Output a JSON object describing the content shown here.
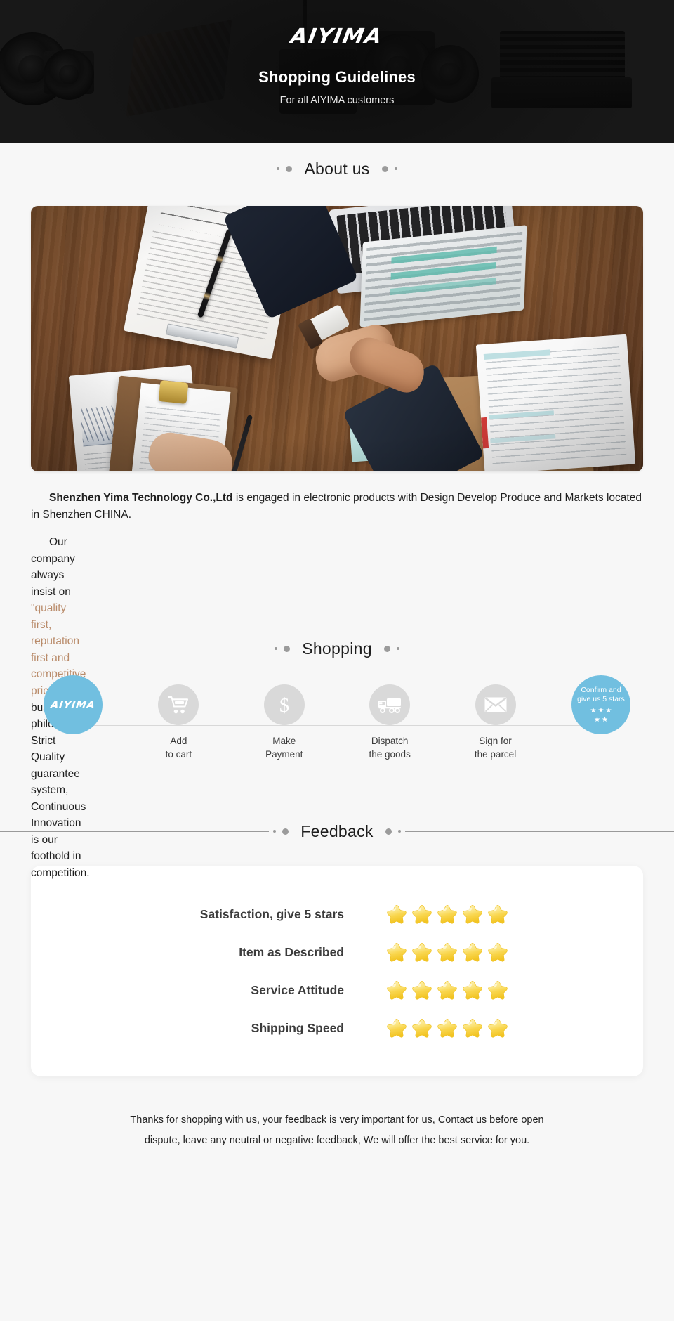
{
  "banner": {
    "logo": "AIYIMA",
    "title": "Shopping Guidelines",
    "subtitle": "For all AIYIMA customers"
  },
  "sections": {
    "about": {
      "title": "About us"
    },
    "shopping": {
      "title": "Shopping"
    },
    "feedback": {
      "title": "Feedback"
    }
  },
  "about": {
    "photo_alt": "business-handshake-over-desk-photo",
    "paragraph1_company": "Shenzhen Yima Technology Co.,Ltd",
    "paragraph1_rest": " is engaged in electronic products with Design Develop Produce and Markets located in Shenzhen CHINA.",
    "paragraph2_before": "Our company always insist on ",
    "paragraph2_quote": "\"quality first, reputation first and competitive price\"",
    "paragraph2_after": " bussiness philosophy. Strict Quality guarantee system, Continuous Innovation is our foothold in competition."
  },
  "shopping": {
    "steps": [
      {
        "icon": "aiyima-logo-icon",
        "label_line1": "AIYIMA",
        "label_line2": "",
        "style": "brand"
      },
      {
        "icon": "shopping-cart-icon",
        "label_line1": "Add",
        "label_line2": "to cart",
        "style": "gray"
      },
      {
        "icon": "dollar-sign-icon",
        "label_line1": "Make",
        "label_line2": "Payment",
        "style": "gray"
      },
      {
        "icon": "delivery-truck-icon",
        "label_line1": "Dispatch",
        "label_line2": "the goods",
        "style": "gray"
      },
      {
        "icon": "envelope-icon",
        "label_line1": "Sign for",
        "label_line2": "the parcel",
        "style": "gray"
      },
      {
        "icon": "five-stars-icon",
        "label_line1": "Confirm and",
        "label_line2": "give us 5 stars",
        "style": "end-brand"
      }
    ]
  },
  "feedback": {
    "rows": [
      {
        "label": "Satisfaction, give 5 stars",
        "stars": 5
      },
      {
        "label": "Item as Described",
        "stars": 5
      },
      {
        "label": "Service Attitude",
        "stars": 5
      },
      {
        "label": "Shipping Speed",
        "stars": 5
      }
    ]
  },
  "footer": {
    "line1": "Thanks for shopping with us, your feedback is very important for us, Contact us before open",
    "line2": "dispute, leave any neutral or negative feedback, We will offer the best service for you."
  },
  "colors": {
    "banner_bg": "#1b1b1b",
    "page_bg": "#f7f7f7",
    "brand_blue": "#71bfe0",
    "quote_text": "#b98b6a",
    "star_yellow": "#f7d046",
    "step_gray": "#d9d9d9"
  }
}
